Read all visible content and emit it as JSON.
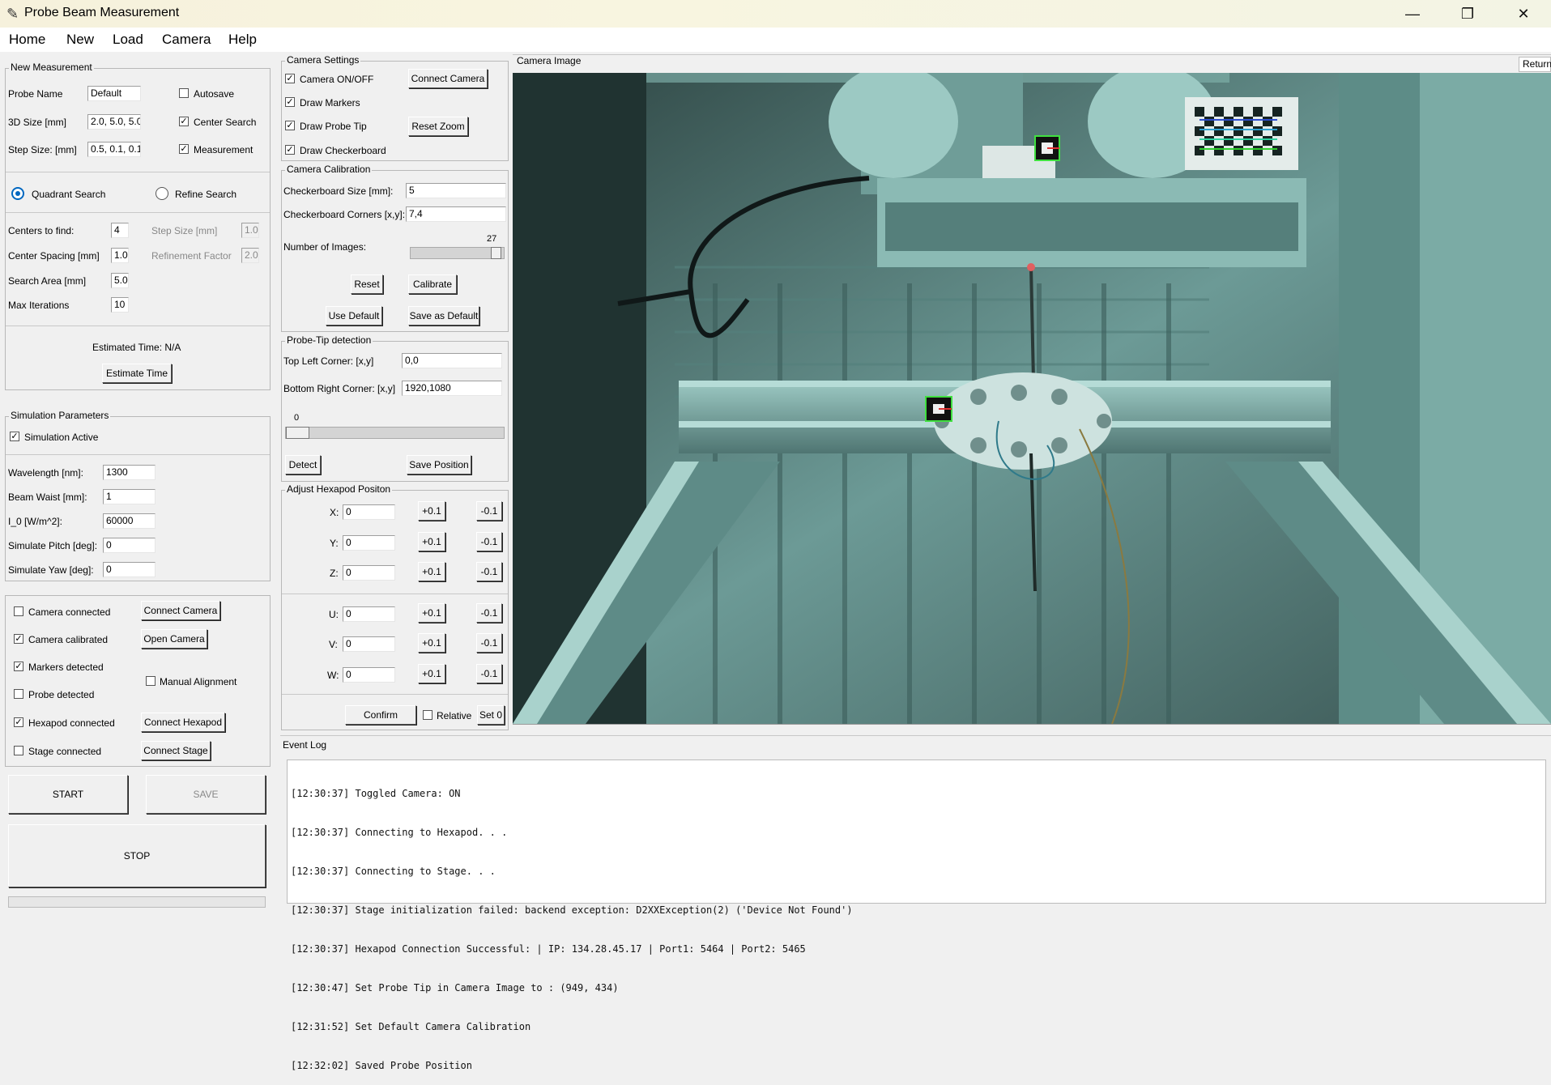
{
  "window": {
    "title": "Probe Beam Measurement",
    "minimize": "—",
    "maximize": "❐",
    "close": "✕"
  },
  "menu": [
    "Home",
    "New",
    "Load",
    "Camera",
    "Help"
  ],
  "new_measurement": {
    "title": "New Measurement",
    "probe_name_label": "Probe Name",
    "probe_name_value": "Default",
    "size_label": "3D Size [mm]",
    "size_value": "2.0, 5.0, 5.0",
    "step_label": "Step Size: [mm]",
    "step_value": "0.5, 0.1, 0.1",
    "autosave_label": "Autosave",
    "autosave_checked": false,
    "center_search_label": "Center Search",
    "center_search_checked": true,
    "measurement_label": "Measurement",
    "measurement_checked": true,
    "quadrant_label": "Quadrant Search",
    "refine_label": "Refine Search",
    "centers_label": "Centers to find:",
    "centers_value": "4",
    "spacing_label": "Center Spacing [mm]",
    "spacing_value": "1.0",
    "area_label": "Search Area [mm]",
    "area_value": "5.0",
    "iter_label": "Max Iterations",
    "iter_value": "10",
    "refine_step_label": "Step Size [mm]",
    "refine_step_value": "1.0",
    "refine_factor_label": "Refinement Factor",
    "refine_factor_value": "2.0",
    "est_time_text": "Estimated Time: N/A",
    "est_button": "Estimate Time"
  },
  "simulation": {
    "title": "Simulation Parameters",
    "active_label": "Simulation Active",
    "active_checked": true,
    "wavelength_label": "Wavelength [nm]:",
    "wavelength_value": "1300",
    "waist_label": "Beam Waist [mm]:",
    "waist_value": "1",
    "i0_label": "I_0 [W/m^2]:",
    "i0_value": "60000",
    "pitch_label": "Simulate Pitch [deg]:",
    "pitch_value": "0",
    "yaw_label": "Simulate Yaw [deg]:",
    "yaw_value": "0"
  },
  "status": {
    "camera_connected": "Camera connected",
    "camera_connected_checked": false,
    "camera_calibrated": "Camera calibrated",
    "camera_calibrated_checked": true,
    "markers_detected": "Markers detected",
    "markers_detected_checked": true,
    "probe_detected": "Probe detected",
    "probe_detected_checked": false,
    "hexapod_connected": "Hexapod connected",
    "hexapod_connected_checked": true,
    "stage_connected": "Stage connected",
    "stage_connected_checked": false,
    "manual_alignment": "Manual Alignment",
    "manual_alignment_checked": false,
    "connect_camera": "Connect Camera",
    "open_camera": "Open Camera",
    "connect_hexapod": "Connect Hexapod",
    "connect_stage": "Connect Stage"
  },
  "actions": {
    "start": "START",
    "save": "SAVE",
    "stop": "STOP"
  },
  "camera_settings": {
    "title": "Camera Settings",
    "on_off": "Camera ON/OFF",
    "draw_markers": "Draw Markers",
    "draw_probe_tip": "Draw Probe Tip",
    "draw_checkerboard": "Draw Checkerboard",
    "connect_camera": "Connect Camera",
    "reset_zoom": "Reset Zoom"
  },
  "calibration": {
    "title": "Camera Calibration",
    "size_label": "Checkerboard Size [mm]:",
    "size_value": "5",
    "corners_label": "Checkerboard Corners [x,y]:",
    "corners_value": "7,4",
    "images_label": "Number of Images:",
    "images_value": "27",
    "images_fraction": 0.93,
    "reset": "Reset",
    "calibrate": "Calibrate",
    "use_default": "Use Default",
    "save_default": "Save as Default"
  },
  "probe_tip": {
    "title": "Probe-Tip detection",
    "top_left_label": "Top Left Corner: [x,y]",
    "top_left_value": "0,0",
    "bottom_right_label": "Bottom Right Corner: [x,y]",
    "bottom_right_value": "1920,1080",
    "slider_value": "0",
    "slider_fraction": 0.0,
    "detect": "Detect",
    "save_position": "Save Position"
  },
  "hexapod": {
    "title": "Adjust Hexapod Positon",
    "axes": [
      {
        "label": "X:",
        "value": "0",
        "plus": "+0.1",
        "minus": "-0.1"
      },
      {
        "label": "Y:",
        "value": "0",
        "plus": "+0.1",
        "minus": "-0.1"
      },
      {
        "label": "Z:",
        "value": "0",
        "plus": "+0.1",
        "minus": "-0.1"
      },
      {
        "label": "U:",
        "value": "0",
        "plus": "+0.1",
        "minus": "-0.1"
      },
      {
        "label": "V:",
        "value": "0",
        "plus": "+0.1",
        "minus": "-0.1"
      },
      {
        "label": "W:",
        "value": "0",
        "plus": "+0.1",
        "minus": "-0.1"
      }
    ],
    "confirm": "Confirm",
    "relative": "Relative",
    "set0": "Set 0"
  },
  "camera_image": {
    "title": "Camera Image",
    "return": "Return"
  },
  "event_log": {
    "title": "Event Log",
    "lines": [
      "[12:30:37] Toggled Camera: ON",
      "[12:30:37] Connecting to Hexapod. . .",
      "[12:30:37] Connecting to Stage. . .",
      "[12:30:37] Stage initialization failed: backend exception: D2XXException(2) ('Device Not Found')",
      "[12:30:37] Hexapod Connection Successful: | IP: 134.28.45.17 | Port1: 5464 | Port2: 5465",
      "[12:30:47] Set Probe Tip in Camera Image to : (949, 434)",
      "[12:31:52] Set Default Camera Calibration",
      "[12:32:02] Saved Probe Position"
    ]
  }
}
